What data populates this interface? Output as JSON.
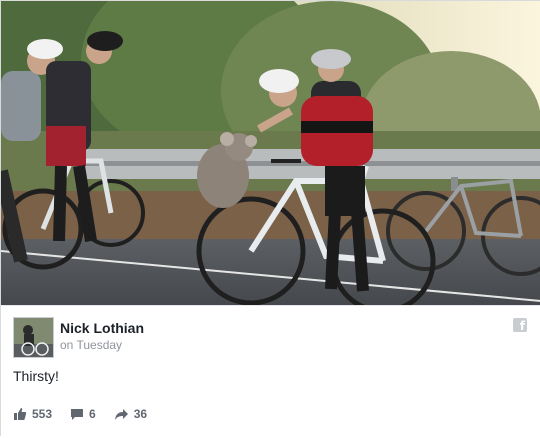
{
  "post": {
    "author": "Nick Lothian",
    "time": "on Tuesday",
    "text": "Thirsty!",
    "stats": {
      "likes": "553",
      "comments": "6",
      "shares": "36"
    }
  },
  "icons": {
    "like": "thumbs-up-icon",
    "comment": "comment-icon",
    "share": "share-arrow-icon",
    "platform": "facebook-icon"
  },
  "colors": {
    "name_text": "#1d2129",
    "meta_text": "#90949c",
    "action_text": "#616770"
  }
}
